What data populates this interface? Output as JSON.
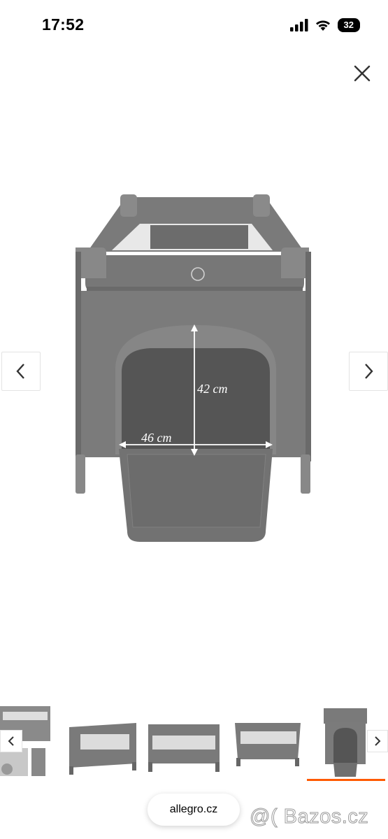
{
  "status_bar": {
    "time": "17:52",
    "battery": "32"
  },
  "dimensions": {
    "height": "42 cm",
    "width": "46 cm"
  },
  "url_pill": {
    "label": "allegro.cz"
  },
  "watermark": {
    "text": "@( Bazos.cz"
  },
  "thumbnails": {
    "count": 5,
    "active_index": 4
  },
  "colors": {
    "accent": "#ff5a00",
    "fabric": "#6f6f6f",
    "fabric_dark": "#555555"
  },
  "icons": [
    "close-icon",
    "chevron-left-icon",
    "chevron-right-icon",
    "signal-icon",
    "wifi-icon"
  ]
}
